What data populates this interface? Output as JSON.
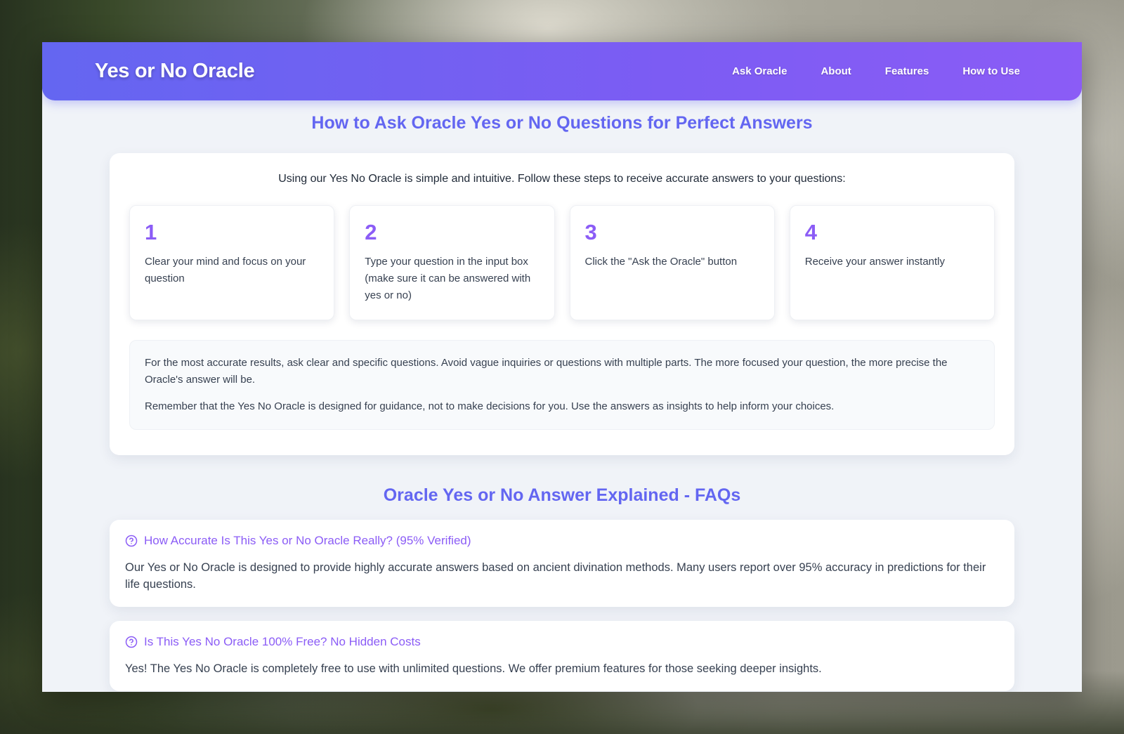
{
  "header": {
    "brand": "Yes or No Oracle",
    "nav": [
      {
        "label": "Ask Oracle"
      },
      {
        "label": "About"
      },
      {
        "label": "Features"
      },
      {
        "label": "How to Use"
      }
    ]
  },
  "how_to": {
    "title": "How to Ask Oracle Yes or No Questions for Perfect Answers",
    "intro": "Using our Yes No Oracle is simple and intuitive. Follow these steps to receive accurate answers to your questions:",
    "steps": [
      {
        "num": "1",
        "text": "Clear your mind and focus on your question"
      },
      {
        "num": "2",
        "text": "Type your question in the input box (make sure it can be answered with yes or no)"
      },
      {
        "num": "3",
        "text": "Click the \"Ask the Oracle\" button"
      },
      {
        "num": "4",
        "text": "Receive your answer instantly"
      }
    ],
    "tips": [
      "For the most accurate results, ask clear and specific questions. Avoid vague inquiries or questions with multiple parts. The more focused your question, the more precise the Oracle's answer will be.",
      "Remember that the Yes No Oracle is designed for guidance, not to make decisions for you. Use the answers as insights to help inform your choices."
    ]
  },
  "faq": {
    "title": "Oracle Yes or No Answer Explained - FAQs",
    "items": [
      {
        "icon": "question-circle-icon",
        "question": "How Accurate Is This Yes or No Oracle Really? (95% Verified)",
        "answer": "Our Yes or No Oracle is designed to provide highly accurate answers based on ancient divination methods. Many users report over 95% accuracy in predictions for their life questions."
      },
      {
        "icon": "question-circle-icon",
        "question": "Is This Yes No Oracle 100% Free? No Hidden Costs",
        "answer": "Yes! The Yes No Oracle is completely free to use with unlimited questions. We offer premium features for those seeking deeper insights."
      }
    ]
  },
  "colors": {
    "accent": "#6366f1",
    "accent_purple": "#8b5cf6"
  }
}
